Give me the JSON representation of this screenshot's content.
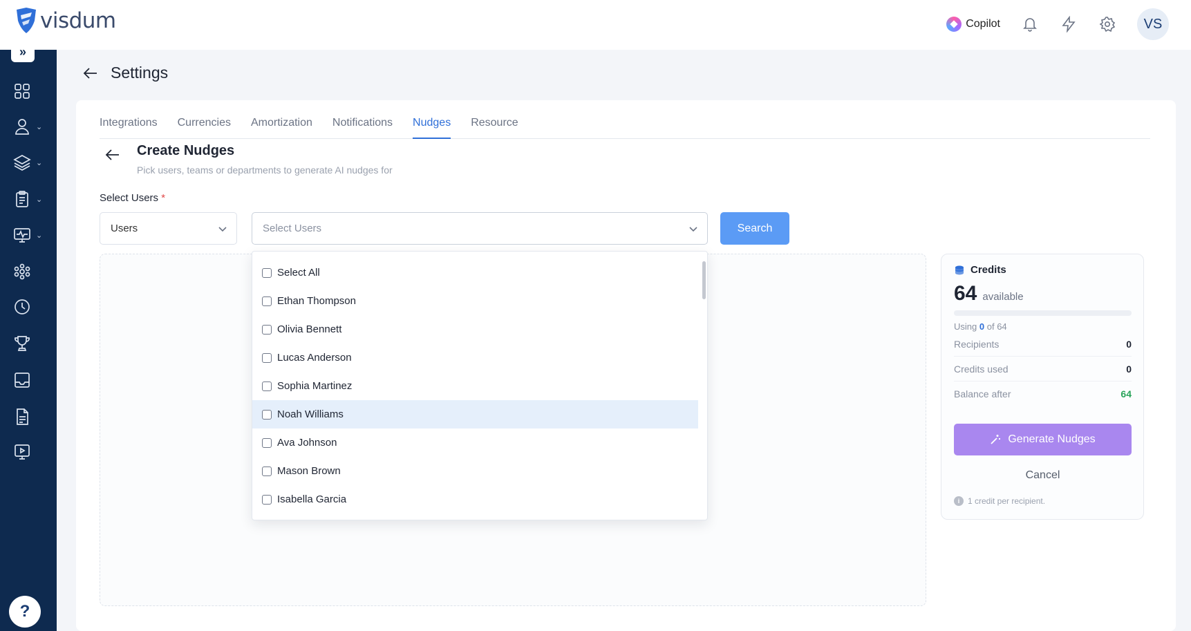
{
  "brand": {
    "name": "visdum"
  },
  "topbar": {
    "copilot_label": "Copilot",
    "icons": [
      "copilot-icon",
      "bell-icon",
      "lightning-icon",
      "gear-icon"
    ],
    "avatar_initials": "VS"
  },
  "sidebar": {
    "expand_icon": "double-chevron-right-icon",
    "items": [
      {
        "icon": "dashboard-grid-icon",
        "has_submenu": false
      },
      {
        "icon": "user-icon",
        "has_submenu": true
      },
      {
        "icon": "layers-icon",
        "has_submenu": true
      },
      {
        "icon": "clipboard-icon",
        "has_submenu": true
      },
      {
        "icon": "monitor-pulse-icon",
        "has_submenu": true
      },
      {
        "icon": "team-network-icon",
        "has_submenu": false
      },
      {
        "icon": "clock-icon",
        "has_submenu": false
      },
      {
        "icon": "trophy-icon",
        "has_submenu": false
      },
      {
        "icon": "inbox-icon",
        "has_submenu": false
      },
      {
        "icon": "document-icon",
        "has_submenu": false
      },
      {
        "icon": "presentation-icon",
        "has_submenu": false
      }
    ],
    "help_label": "?"
  },
  "page": {
    "title": "Settings"
  },
  "tabs": [
    {
      "label": "Integrations",
      "active": false
    },
    {
      "label": "Currencies",
      "active": false
    },
    {
      "label": "Amortization",
      "active": false
    },
    {
      "label": "Notifications",
      "active": false
    },
    {
      "label": "Nudges",
      "active": true
    },
    {
      "label": "Resource",
      "active": false
    }
  ],
  "section": {
    "title": "Create Nudges",
    "subtitle": "Pick users, teams or departments to generate AI nudges for"
  },
  "form": {
    "label": "Select Users",
    "required_mark": "*",
    "type_select_value": "Users",
    "user_select_placeholder": "Select Users",
    "search_label": "Search"
  },
  "dropdown": {
    "items": [
      {
        "label": "Select All",
        "checked": false
      },
      {
        "label": "Ethan Thompson",
        "checked": false
      },
      {
        "label": "Olivia Bennett",
        "checked": false
      },
      {
        "label": "Lucas Anderson",
        "checked": false
      },
      {
        "label": "Sophia Martinez",
        "checked": false
      },
      {
        "label": "Noah Williams",
        "checked": false,
        "hovered": true
      },
      {
        "label": "Ava Johnson",
        "checked": false
      },
      {
        "label": "Mason Brown",
        "checked": false
      },
      {
        "label": "Isabella Garcia",
        "checked": false
      }
    ]
  },
  "credits": {
    "title": "Credits",
    "available_value": "64",
    "available_label": "available",
    "usage_fraction": 0,
    "using_prefix": "Using",
    "using_value": "0",
    "using_suffix": "of 64",
    "rows": [
      {
        "label": "Recipients",
        "value": "0"
      },
      {
        "label": "Credits used",
        "value": "0"
      },
      {
        "label": "Balance after",
        "value": "64"
      }
    ],
    "generate_label": "Generate Nudges",
    "cancel_label": "Cancel",
    "note": "1 credit per recipient.",
    "colors": {
      "balance_positive": "#29a35a",
      "generate_button": "#a987ef",
      "accent": "#2f6fd8"
    }
  }
}
